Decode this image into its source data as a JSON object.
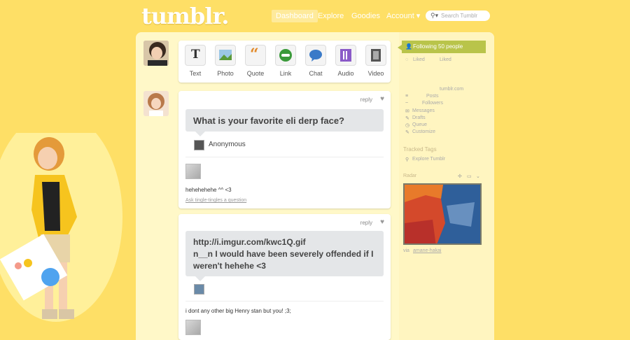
{
  "header": {
    "logo": "tumblr.",
    "nav": [
      "Dashboard",
      "Explore",
      "Goodies",
      "Account ▾"
    ],
    "search_placeholder": "Search Tumblr"
  },
  "post_types": [
    "Text",
    "Photo",
    "Quote",
    "Link",
    "Chat",
    "Audio",
    "Video"
  ],
  "posts": [
    {
      "reply_label": "reply",
      "question": "What is your favorite eli derp face?",
      "asker": "Anonymous",
      "answer": "hehehehehe ^^ <3",
      "ask_link": "Ask tingle-tingles a question"
    },
    {
      "reply_label": "reply",
      "question_lines": [
        "http://i.imgur.com/kwc1Q.gif",
        "n__n I would have been severely offended if I",
        "weren't hehehe <3"
      ],
      "answer": "i dont any other big Henry stan but you! ;3;"
    }
  ],
  "sidebar": {
    "following": "Following 50 people",
    "tabs": [
      "Liked",
      "Liked"
    ],
    "blog_title": "tumblr.com",
    "links": [
      {
        "icon": "≡",
        "label": "Posts"
      },
      {
        "icon": "~",
        "label": "Followers"
      },
      {
        "icon": "✉",
        "label": "Messages"
      },
      {
        "icon": "✎",
        "label": "Drafts"
      },
      {
        "icon": "◷",
        "label": "Queue"
      },
      {
        "icon": "✎",
        "label": "Customize"
      }
    ],
    "pages_header": "Tracked Tags",
    "explore_label": "Explore Tumblr",
    "radar_label": "Radar",
    "radar_credit": "via",
    "radar_user": "amane-hakai"
  },
  "colors": {
    "background": "#fedf66",
    "panel": "#fff8c8",
    "following": "#b9c44a"
  }
}
